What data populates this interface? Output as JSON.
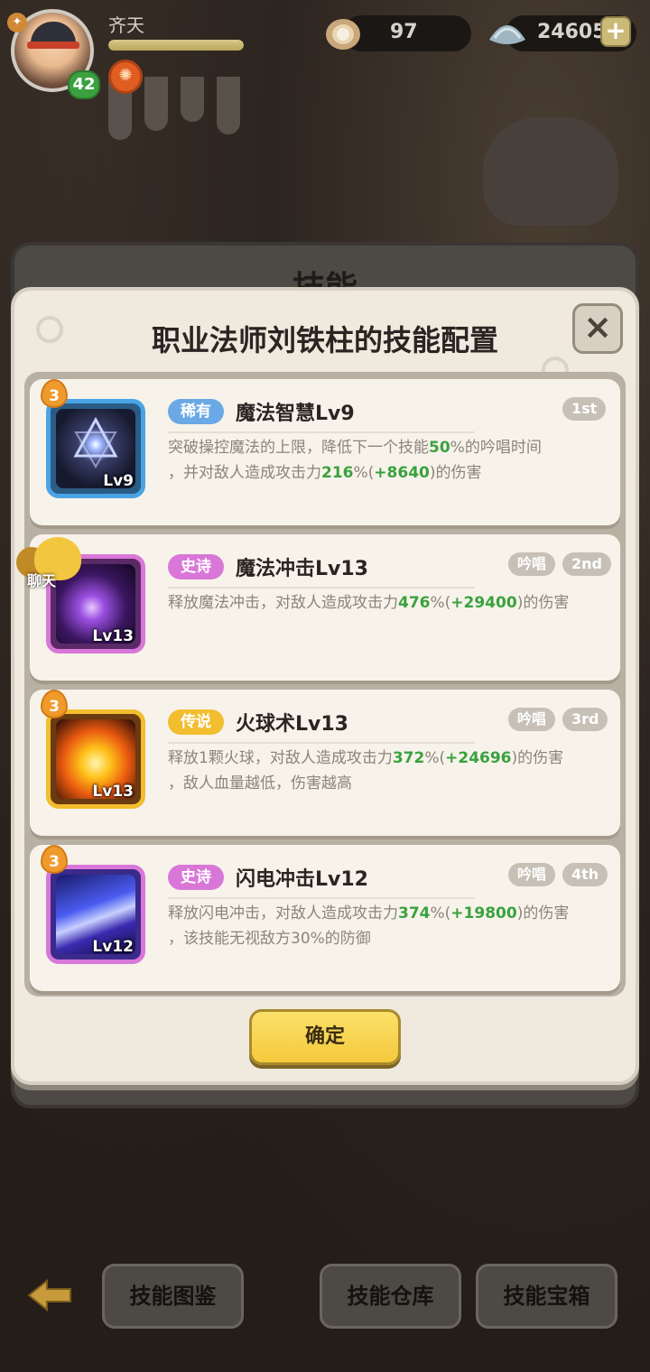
{
  "player": {
    "name": "齐天",
    "level": "42",
    "exp_fraction": 1.0
  },
  "resources": {
    "pearls": "97",
    "shells": "24605"
  },
  "background_title": "技能",
  "dialog": {
    "title": "职业法师刘铁柱的技能配置",
    "close_icon": "×",
    "confirm_label": "确定"
  },
  "chat": {
    "label": "聊天"
  },
  "skills": [
    {
      "rarity": "稀有",
      "rarity_color": "#6aa9e6",
      "name": "魔法智慧Lv9",
      "icon_level": "Lv9",
      "drop": "3",
      "rank": "1st",
      "chant": "",
      "desc1_a": "突破操控魔法的上限，降低下一个技能",
      "desc1_v1": "50",
      "desc1_b": "%的吟唱时间",
      "desc2_a": "，并对敌人造成攻击力",
      "desc2_v1": "216",
      "desc2_b": "%(",
      "desc2_v2": "+8640",
      "desc2_c": ")的伤害"
    },
    {
      "rarity": "史诗",
      "rarity_color": "#d977d8",
      "name": "魔法冲击Lv13",
      "icon_level": "Lv13",
      "drop": "",
      "rank": "2nd",
      "chant": "吟唱",
      "desc1_a": "释放魔法冲击，对敌人造成攻击力",
      "desc1_v1": "476",
      "desc1_b": "%(",
      "desc1_v2": "+29400",
      "desc1_c": ")的伤害"
    },
    {
      "rarity": "传说",
      "rarity_color": "#f2bd2e",
      "name": "火球术Lv13",
      "icon_level": "Lv13",
      "drop": "3",
      "rank": "3rd",
      "chant": "吟唱",
      "desc1_a": "释放1颗火球，对敌人造成攻击力",
      "desc1_v1": "372",
      "desc1_b": "%(",
      "desc1_v2": "+24696",
      "desc1_c": ")的伤害",
      "desc2_a": "，敌人血量越低，伤害越高"
    },
    {
      "rarity": "史诗",
      "rarity_color": "#d977d8",
      "name": "闪电冲击Lv12",
      "icon_level": "Lv12",
      "drop": "3",
      "rank": "4th",
      "chant": "吟唱",
      "desc1_a": "释放闪电冲击，对敌人造成攻击力",
      "desc1_v1": "374",
      "desc1_b": "%(",
      "desc1_v2": "+19800",
      "desc1_c": ")的伤害",
      "desc2_a": "，该技能无视敌方30%的防御"
    }
  ],
  "bottom_nav": {
    "compendium": "技能图鉴",
    "warehouse": "技能仓库",
    "chest": "技能宝箱"
  }
}
